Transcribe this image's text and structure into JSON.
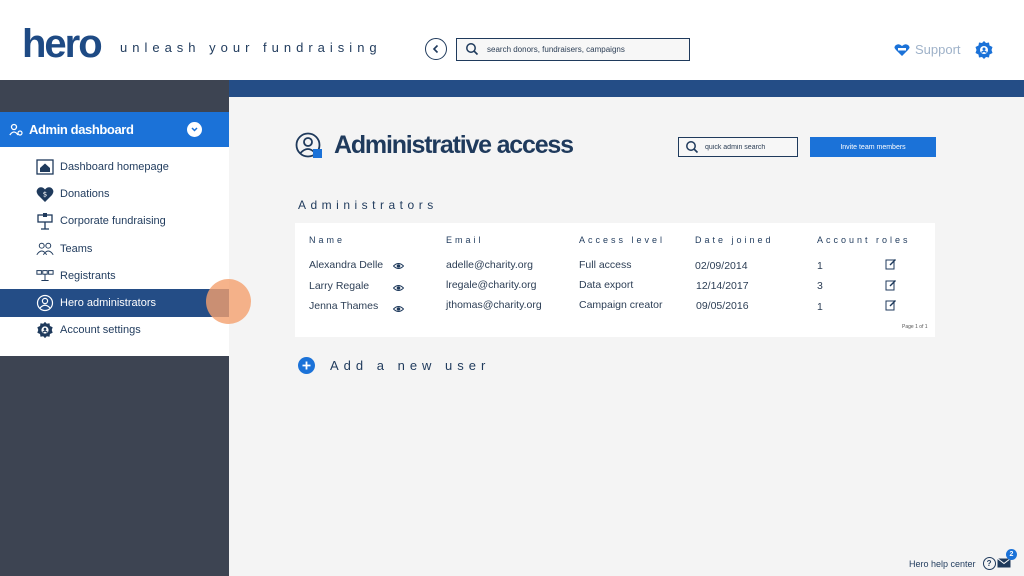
{
  "header": {
    "logo": "hero",
    "tagline": "unleash your fundraising",
    "search_placeholder": "search donors, fundraisers, campaigns",
    "support_label": "Support"
  },
  "sidebar": {
    "title": "Admin dashboard",
    "items": [
      {
        "label": "Dashboard homepage",
        "icon": "home-icon"
      },
      {
        "label": "Donations",
        "icon": "heart-dollar-icon"
      },
      {
        "label": "Corporate fundraising",
        "icon": "corporate-icon"
      },
      {
        "label": "Teams",
        "icon": "team-icon"
      },
      {
        "label": "Registrants",
        "icon": "registrants-icon"
      },
      {
        "label": "Hero administrators",
        "icon": "admin-icon",
        "active": true
      },
      {
        "label": "Account settings",
        "icon": "gear-icon"
      }
    ]
  },
  "main": {
    "title": "Administrative access",
    "admin_search_placeholder": "quick admin search",
    "invite_label": "Invite team members",
    "section_title": "Administrators",
    "columns": [
      "Name",
      "Email",
      "Access level",
      "Date joined",
      "Account roles"
    ],
    "rows": [
      {
        "name": "Alexandra Delle",
        "email": "adelle@charity.org",
        "access": "Full access",
        "date": "02/09/2014",
        "roles": "1"
      },
      {
        "name": "Larry Regale",
        "email": "lregale@charity.org",
        "access": "Data export",
        "date": "12/14/2017",
        "roles": "3"
      },
      {
        "name": "Jenna Thames",
        "email": "jthomas@charity.org",
        "access": "Campaign creator",
        "date": "09/05/2016",
        "roles": "1"
      }
    ],
    "pager": "Page 1 of 1",
    "add_user_label": "Add a new user"
  },
  "footer": {
    "help_label": "Hero help center",
    "help_symbol": "?",
    "mail_count": "2"
  },
  "colors": {
    "brand_navy": "#1f3a5c",
    "accent_blue": "#1b72d8",
    "band_blue": "#244d86",
    "sidebar_dark": "#3d4452"
  }
}
